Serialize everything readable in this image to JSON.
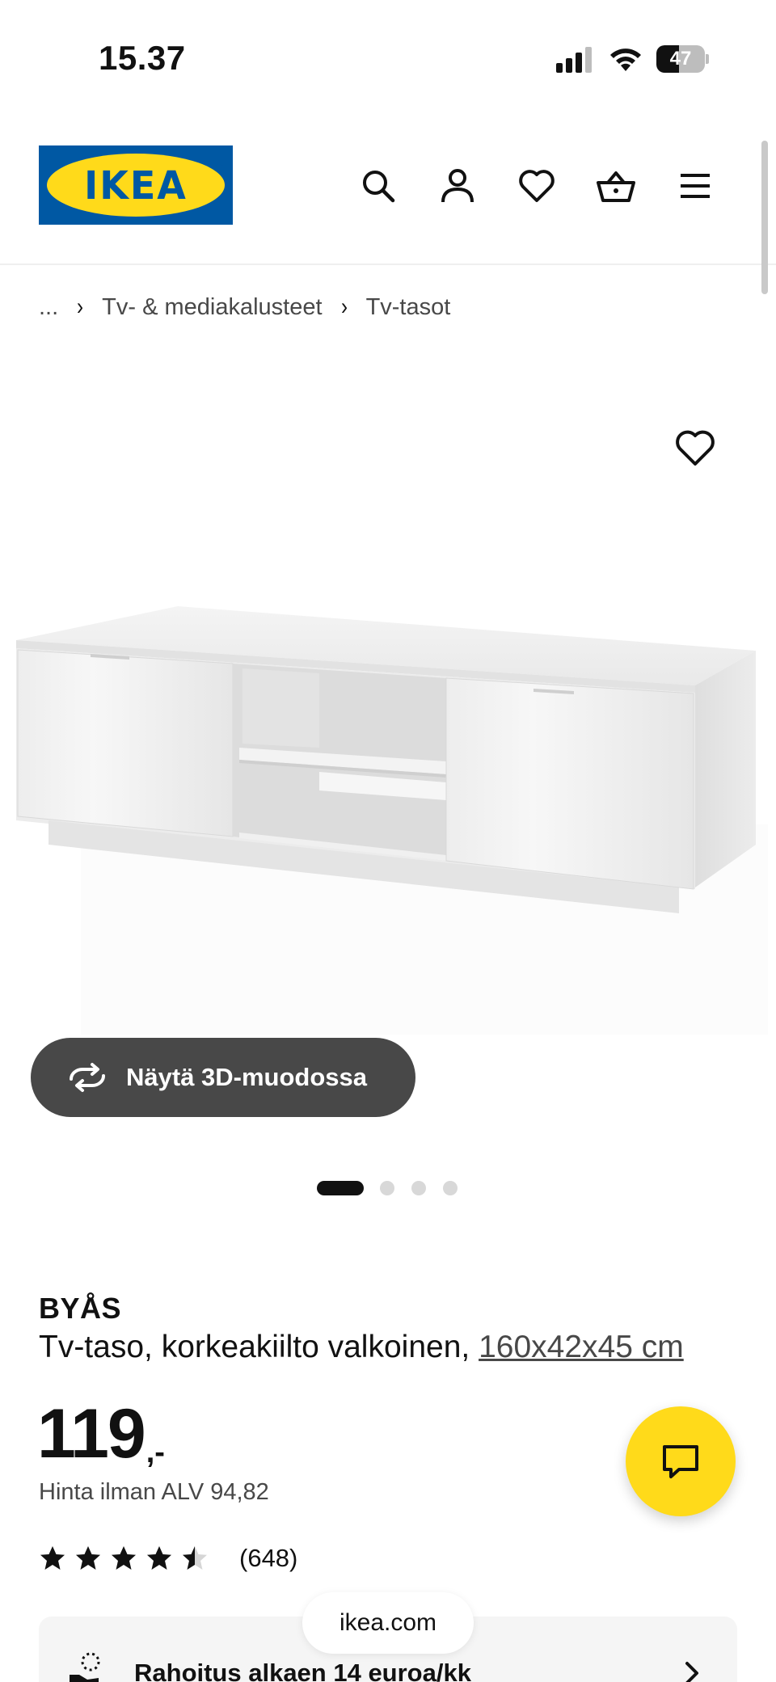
{
  "status_bar": {
    "time": "15.37",
    "battery": "47",
    "battery_level": 0.47
  },
  "header": {
    "logo_text": "IKEA",
    "icons": [
      "search-icon",
      "user-icon",
      "heart-icon",
      "basket-icon",
      "menu-icon"
    ]
  },
  "breadcrumb": {
    "ellipsis": "...",
    "items": [
      "Tv- & mediakalusteet",
      "Tv-tasot"
    ]
  },
  "gallery": {
    "view_3d_label": "Näytä 3D-muodossa",
    "image_count": 4,
    "active_index": 0
  },
  "product": {
    "name": "BYÅS",
    "description": "Tv-taso, korkeakiilto valkoinen,",
    "size": "160x42x45 cm",
    "price": "119",
    "price_suffix": ",-",
    "vat_text": "Hinta ilman ALV 94,82",
    "rating": 4.5,
    "rating_count": "(648)"
  },
  "finance": {
    "label": "Rahoitus alkaen 14 euroa/kk"
  },
  "browser": {
    "url": "ikea.com"
  },
  "colors": {
    "ikea_blue": "#0058a3",
    "ikea_yellow": "#ffda1a",
    "button_dark": "#484848"
  }
}
